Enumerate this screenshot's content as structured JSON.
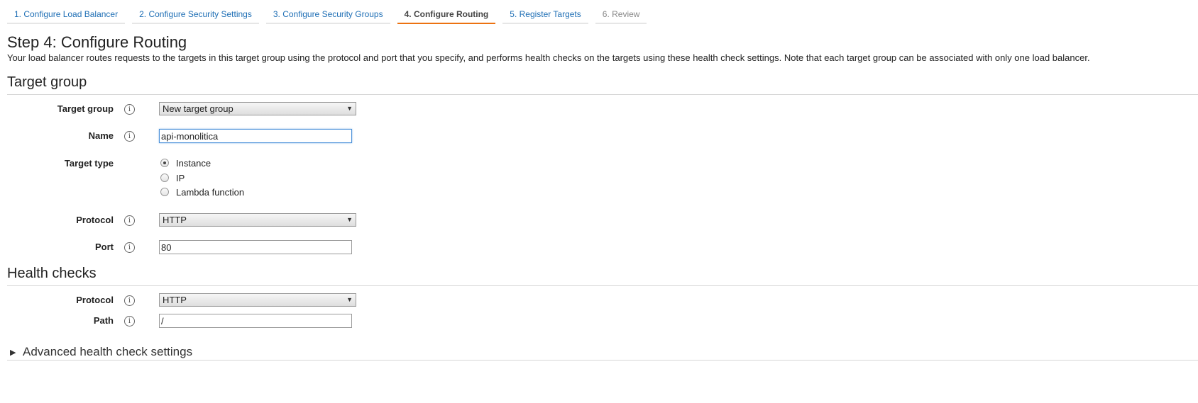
{
  "steps": [
    {
      "label": "1. Configure Load Balancer"
    },
    {
      "label": "2. Configure Security Settings"
    },
    {
      "label": "3. Configure Security Groups"
    },
    {
      "label": "4. Configure Routing"
    },
    {
      "label": "5. Register Targets"
    },
    {
      "label": "6. Review"
    }
  ],
  "page": {
    "title": "Step 4: Configure Routing",
    "description": "Your load balancer routes requests to the targets in this target group using the protocol and port that you specify, and performs health checks on the targets using these health check settings. Note that each target group can be associated with only one load balancer."
  },
  "target_group": {
    "section_title": "Target group",
    "target_group_label": "Target group",
    "target_group_value": "New target group",
    "name_label": "Name",
    "name_value": "api-monolitica",
    "target_type_label": "Target type",
    "target_type_options": [
      "Instance",
      "IP",
      "Lambda function"
    ],
    "protocol_label": "Protocol",
    "protocol_value": "HTTP",
    "port_label": "Port",
    "port_value": "80"
  },
  "health_checks": {
    "section_title": "Health checks",
    "protocol_label": "Protocol",
    "protocol_value": "HTTP",
    "path_label": "Path",
    "path_value": "/"
  },
  "advanced": {
    "label": "Advanced health check settings"
  },
  "icons": {
    "info": "i",
    "dropdown_arrow": "▼",
    "expand": "▶"
  },
  "colors": {
    "active_tab_underline": "#ec7211",
    "link": "#1f6fb5"
  }
}
